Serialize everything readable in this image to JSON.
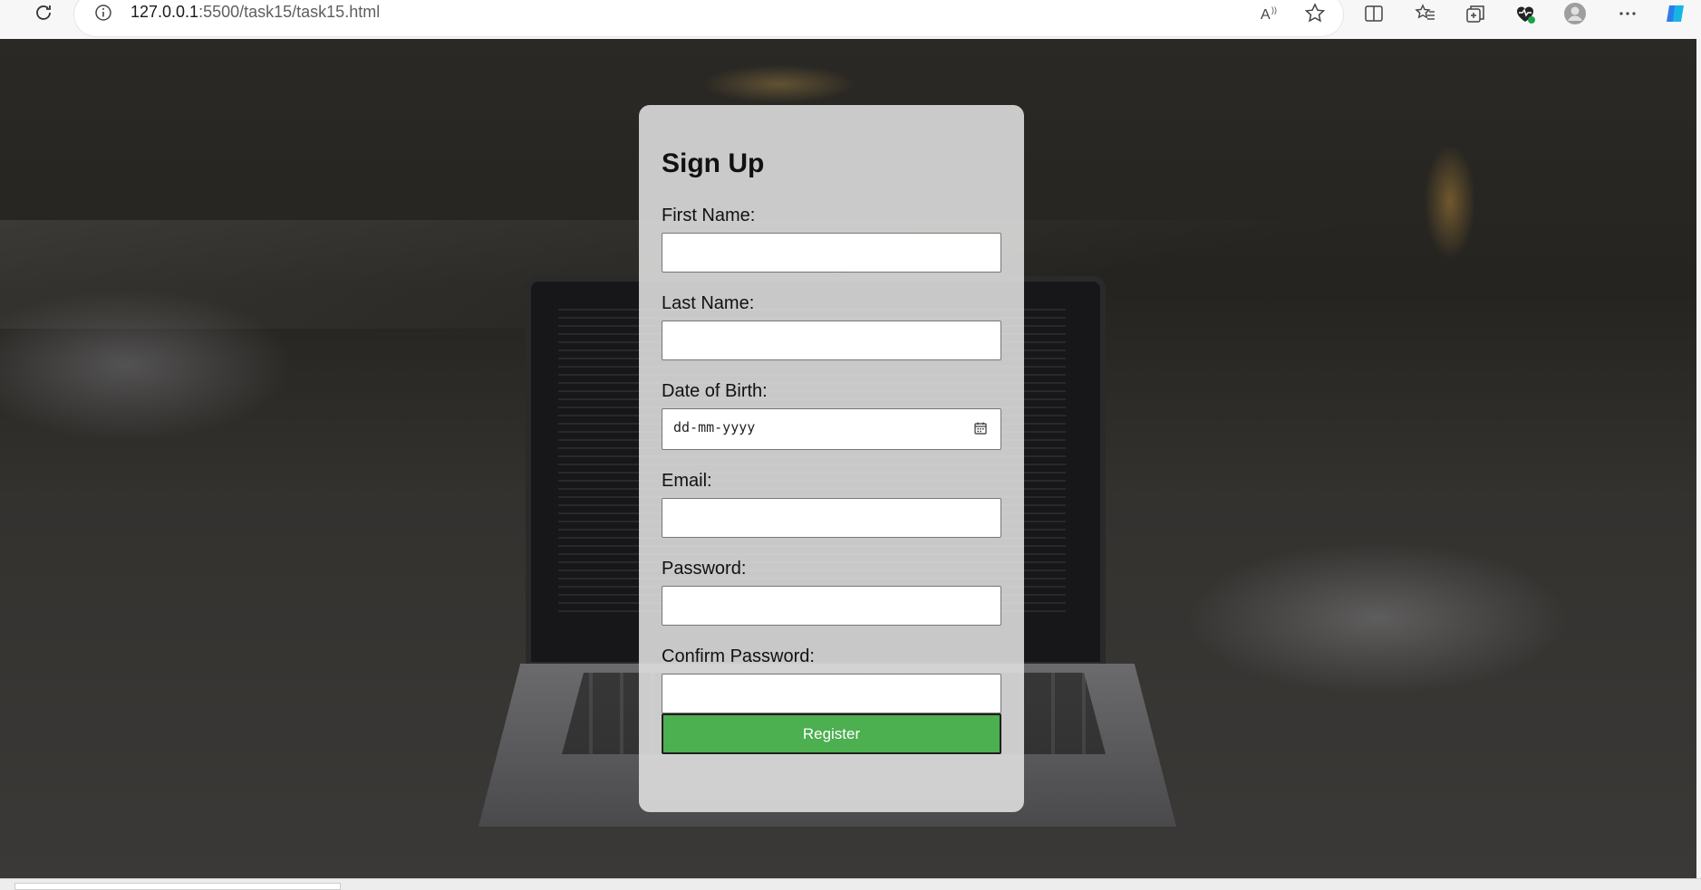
{
  "browser": {
    "url_host": "127.0.0.1",
    "url_path": ":5500/task15/task15.html",
    "toolbar_icons": [
      "read-aloud-icon",
      "favorite-star-icon",
      "split-screen-icon",
      "favorites-icon",
      "collections-icon",
      "browser-essentials-icon",
      "profile-icon",
      "more-options-icon",
      "copilot-icon"
    ]
  },
  "form": {
    "title": "Sign Up",
    "fields": [
      {
        "label": "First Name:",
        "value": ""
      },
      {
        "label": "Last Name:",
        "value": ""
      },
      {
        "label": "Date of Birth:",
        "placeholder": "dd-mm-yyyy"
      },
      {
        "label": "Email:",
        "value": ""
      },
      {
        "label": "Password:",
        "value": ""
      },
      {
        "label": "Confirm Password:",
        "value": ""
      }
    ],
    "submit_label": "Register"
  },
  "colors": {
    "register_button": "#4caf50",
    "card_background": "#e1e1e1"
  }
}
